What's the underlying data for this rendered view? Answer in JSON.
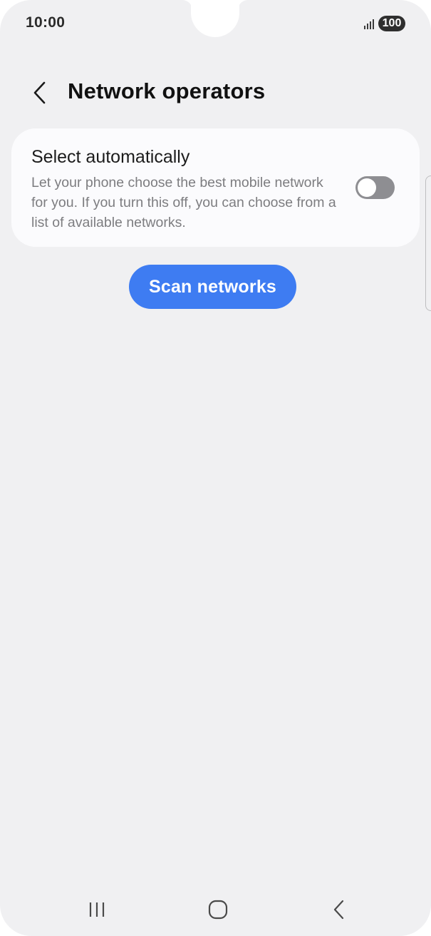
{
  "status_bar": {
    "time": "10:00",
    "battery": "100"
  },
  "header": {
    "title": "Network operators"
  },
  "auto_select": {
    "title": "Select automatically",
    "description": "Let your phone choose the best mobile network for you. If you turn this off, you can choose from a list of available networks.",
    "toggle_on": false
  },
  "actions": {
    "scan_label": "Scan networks"
  },
  "colors": {
    "background": "#f0f0f2",
    "card": "#fbfbfd",
    "accent": "#3e7cf2",
    "toggle_off": "#8e8e92"
  },
  "icons": {
    "back": "chevron-left-icon",
    "nav_recents": "recents-icon",
    "nav_home": "home-icon",
    "nav_back": "back-icon"
  }
}
